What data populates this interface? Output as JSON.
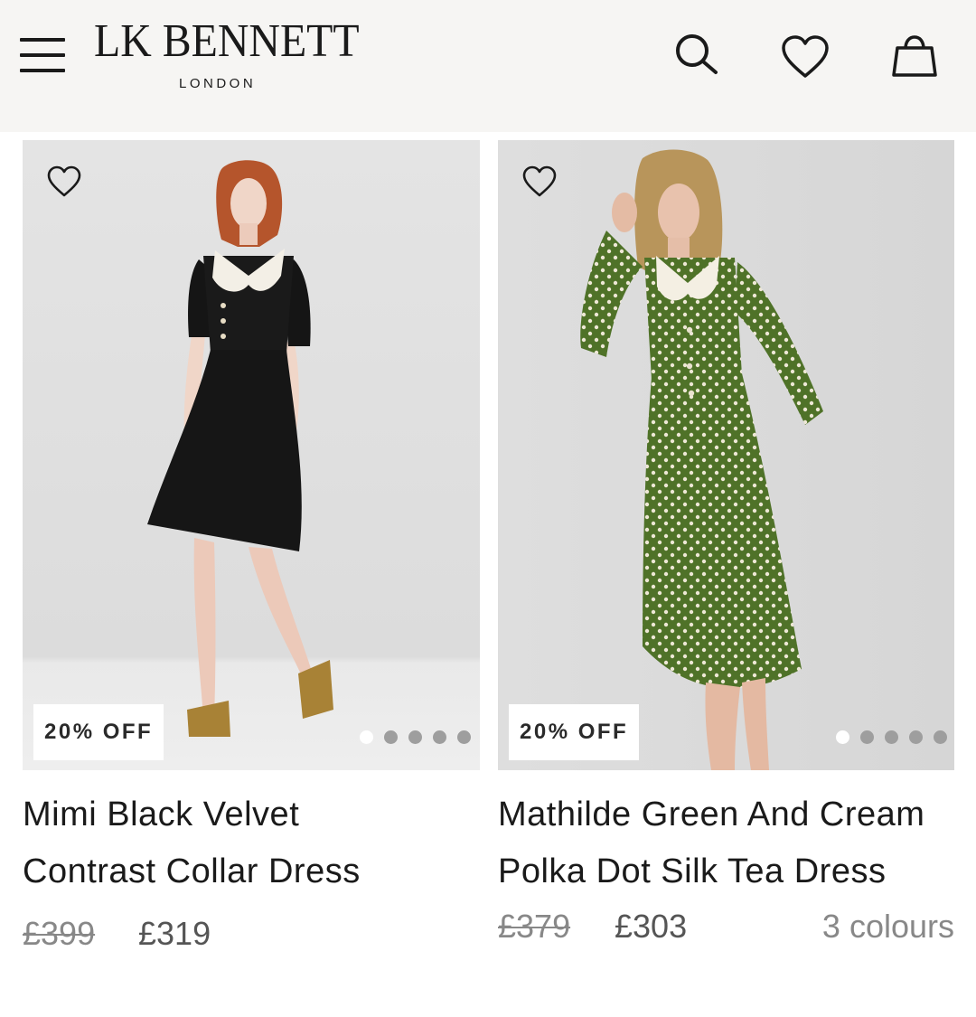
{
  "header": {
    "logo_main": "LK BENNETT",
    "logo_sub": "LONDON",
    "bg": "#f6f5f3"
  },
  "icons": {
    "menu": "hamburger-icon",
    "search": "search-icon",
    "wishlist": "heart-icon",
    "bag": "shopping-bag-icon"
  },
  "products": [
    {
      "name": "Mimi Black Velvet Contrast Collar Dress",
      "badge": "20% OFF",
      "old_price": "£399",
      "price": "£319",
      "colours": "",
      "dots": 5,
      "active_dot": 0
    },
    {
      "name": "Mathilde Green And Cream Polka Dot Silk Tea Dress",
      "badge": "20% OFF",
      "old_price": "£379",
      "price": "£303",
      "colours": "3 colours",
      "dots": 5,
      "active_dot": 0
    }
  ]
}
